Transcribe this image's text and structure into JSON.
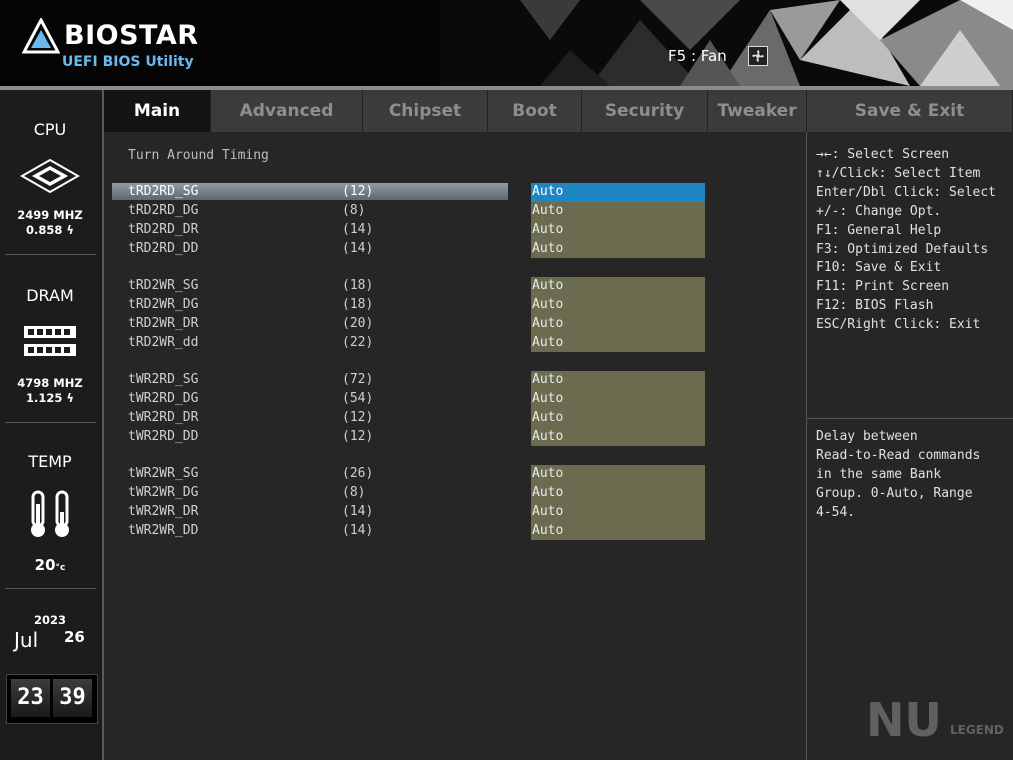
{
  "header": {
    "brand": "BIOSTAR",
    "subtitle": "UEFI BIOS Utility",
    "fan_hint": "F5 : Fan"
  },
  "sidebar": {
    "cpu": {
      "title": "CPU",
      "freq": "2499 MHZ",
      "volt": "0.858"
    },
    "dram": {
      "title": "DRAM",
      "freq": "4798 MHZ",
      "volt": "1.125"
    },
    "temp": {
      "title": "TEMP",
      "value": "20"
    },
    "date": {
      "year": "2023",
      "month": "Jul",
      "day": "26"
    },
    "clock": {
      "hh": "23",
      "mm": "39"
    }
  },
  "tabs": [
    "Main",
    "Advanced",
    "Chipset",
    "Boot",
    "Security",
    "Tweaker",
    "Save & Exit"
  ],
  "section_title": "Turn Around Timing",
  "rows": [
    {
      "label": "tRD2RD_SG",
      "current": "(12)",
      "value": "Auto"
    },
    {
      "label": "tRD2RD_DG",
      "current": "(8)",
      "value": "Auto"
    },
    {
      "label": "tRD2RD_DR",
      "current": "(14)",
      "value": "Auto"
    },
    {
      "label": "tRD2RD_DD",
      "current": "(14)",
      "value": "Auto"
    },
    {
      "label": "tRD2WR_SG",
      "current": "(18)",
      "value": "Auto"
    },
    {
      "label": "tRD2WR_DG",
      "current": "(18)",
      "value": "Auto"
    },
    {
      "label": "tRD2WR_DR",
      "current": "(20)",
      "value": "Auto"
    },
    {
      "label": "tRD2WR_dd",
      "current": "(22)",
      "value": "Auto"
    },
    {
      "label": "tWR2RD_SG",
      "current": "(72)",
      "value": "Auto"
    },
    {
      "label": "tWR2RD_DG",
      "current": "(54)",
      "value": "Auto"
    },
    {
      "label": "tWR2RD_DR",
      "current": "(12)",
      "value": "Auto"
    },
    {
      "label": "tWR2RD_DD",
      "current": "(12)",
      "value": "Auto"
    },
    {
      "label": "tWR2WR_SG",
      "current": "(26)",
      "value": "Auto"
    },
    {
      "label": "tWR2WR_DG",
      "current": "(8)",
      "value": "Auto"
    },
    {
      "label": "tWR2WR_DR",
      "current": "(14)",
      "value": "Auto"
    },
    {
      "label": "tWR2WR_DD",
      "current": "(14)",
      "value": "Auto"
    }
  ],
  "keys_help": [
    "→←: Select Screen",
    "↑↓/Click: Select Item",
    "Enter/Dbl Click: Select",
    "+/-: Change Opt.",
    "F1: General Help",
    "F3: Optimized Defaults",
    "F10: Save & Exit",
    "F11: Print Screen",
    "F12: BIOS Flash",
    "ESC/Right Click: Exit"
  ],
  "item_help": [
    "Delay between",
    "Read-to-Read commands",
    "in the same Bank",
    "Group. 0-Auto, Range",
    "4-54."
  ],
  "watermark": {
    "logo": "NU",
    "text": "LEGEND"
  },
  "colors": {
    "selected": "#1f86c4",
    "value_box": "#6b6b4f",
    "brand_blue": "#6bb8f0"
  }
}
